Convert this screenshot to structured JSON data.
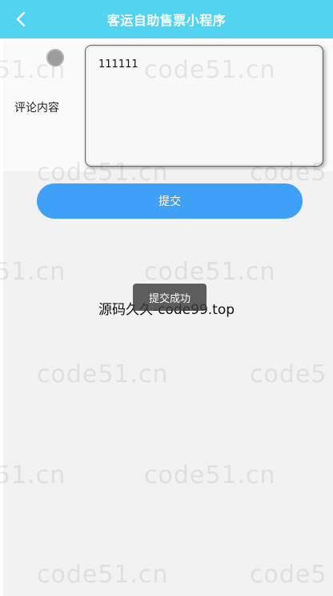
{
  "header": {
    "title": "客运自助售票小程序",
    "back_icon": "chevron-left-icon",
    "bg_color": "#52d3f0"
  },
  "form": {
    "comment_label": "评论内容",
    "comment_value": "111111"
  },
  "submit": {
    "label": "提交",
    "color": "#3fa0f7"
  },
  "toast": {
    "message": "提交成功"
  },
  "overlay_text": "源码久久-code99.top",
  "watermark": {
    "text1": "51.cn",
    "text2": "code51.cn",
    "text3": "code5"
  }
}
